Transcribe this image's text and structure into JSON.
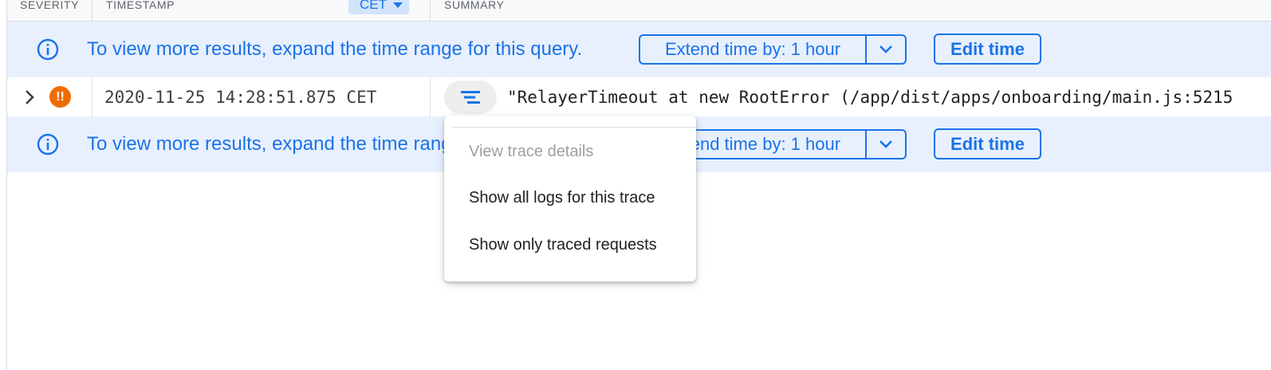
{
  "header": {
    "severity_label": "SEVERITY",
    "timestamp_label": "TIMESTAMP",
    "timezone_chip": "CET",
    "summary_label": "SUMMARY"
  },
  "banners": [
    {
      "message": "To view more results, expand the time range for this query.",
      "extend_label": "Extend time by: 1 hour",
      "edit_label": "Edit time"
    },
    {
      "message": "To view more results, expand the time range for this query.",
      "extend_label": "Extend time by: 1 hour",
      "edit_label": "Edit time"
    }
  ],
  "log_row": {
    "severity_symbol": "!!",
    "severity_color": "#ef6c00",
    "timestamp": "2020-11-25 14:28:51.875 CET",
    "summary": "\"RelayerTimeout at new RootError (/app/dist/apps/onboarding/main.js:5215"
  },
  "trace_menu": {
    "items": [
      {
        "label": "View trace details",
        "enabled": false
      },
      {
        "label": "Show all logs for this trace",
        "enabled": true
      },
      {
        "label": "Show only traced requests",
        "enabled": true
      }
    ]
  },
  "colors": {
    "accent": "#1a73e8",
    "banner_bg": "#e8f0fe",
    "warning": "#ef6c00"
  }
}
